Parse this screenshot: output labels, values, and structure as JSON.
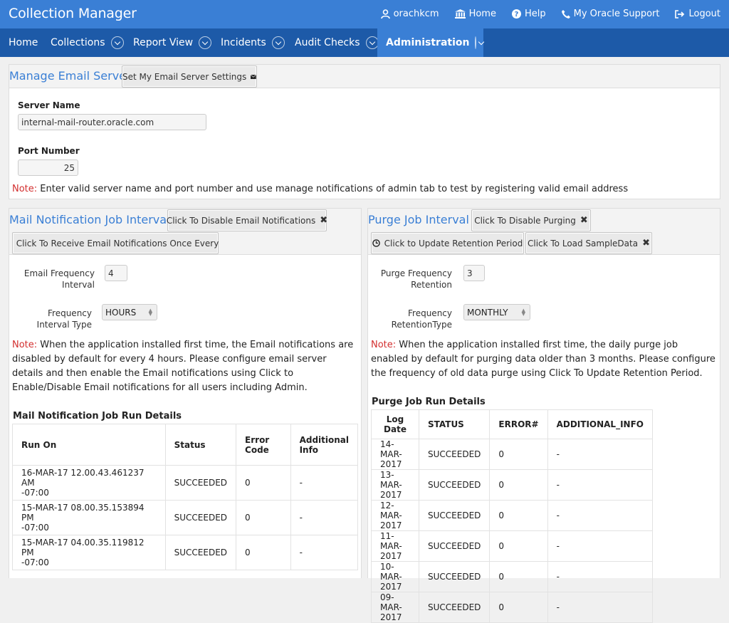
{
  "app": {
    "title": "Collection Manager"
  },
  "top_links": {
    "user": "orachkcm",
    "home": "Home",
    "help": "Help",
    "support": "My Oracle Support",
    "logout": "Logout"
  },
  "nav": {
    "home": "Home",
    "collections": "Collections",
    "report_view": "Report View",
    "incidents": "Incidents",
    "audit_checks": "Audit Checks",
    "administration": "Administration"
  },
  "email_server": {
    "title": "Manage Email Server",
    "set_button": "Set My Email Server Settings",
    "server_label": "Server Name",
    "server_value": "internal-mail-router.oracle.com",
    "port_label": "Port Number",
    "port_value": "25",
    "note_prefix": "Note:",
    "note_text": " Enter valid server name and port number and use manage notifications of admin tab to test by registering valid email address"
  },
  "mail_job": {
    "title": "Mail Notification Job Interval",
    "disable_button": "Click To Disable Email Notifications",
    "receive_button": "Click To Receive Email Notifications Once Every",
    "freq_label_1": "Email Frequency",
    "freq_label_2": "Interval",
    "freq_value": "4",
    "type_label_1": "Frequency",
    "type_label_2": "Interval Type",
    "type_value": "HOURS",
    "note_prefix": "Note:",
    "note_text": " When the application installed first time, the Email notifications are disabled by default for every 4 hours. Please configure email server details and then enable the Email notifications using Click to Enable/Disable Email notifications for all users including Admin.",
    "runs_title": "Mail Notification Job Run Details",
    "headers": {
      "run_on": "Run On",
      "status": "Status",
      "error_1": "Error",
      "error_2": "Code",
      "info_1": "Additional",
      "info_2": "Info"
    },
    "rows": [
      {
        "run_on_1": "16-MAR-17 12.00.43.461237 AM",
        "run_on_2": "-07:00",
        "status": "SUCCEEDED",
        "code": "0",
        "info": "-"
      },
      {
        "run_on_1": "15-MAR-17 08.00.35.153894 PM",
        "run_on_2": "-07:00",
        "status": "SUCCEEDED",
        "code": "0",
        "info": "-"
      },
      {
        "run_on_1": "15-MAR-17 04.00.35.119812 PM",
        "run_on_2": "-07:00",
        "status": "SUCCEEDED",
        "code": "0",
        "info": "-"
      }
    ]
  },
  "purge_job": {
    "title": "Purge Job Interval",
    "disable_button": "Click To Disable Purging",
    "update_button": "Click to Update Retention Period",
    "load_button": "Click To Load SampleData",
    "freq_label_1": "Purge Frequency",
    "freq_label_2": "Retention",
    "freq_value": "3",
    "type_label_1": "Frequency",
    "type_label_2": "RetentionType",
    "type_value": "MONTHLY",
    "note_prefix": "Note:",
    "note_text": " When the application installed first time, the daily purge job enabled by default for purging data older than 3 months. Please configure the frequency of old data purge using Click To Update Retention Period.",
    "runs_title": "Purge Job Run Details",
    "headers": {
      "date": "Log Date",
      "status": "STATUS",
      "error": "ERROR#",
      "info": "ADDITIONAL_INFO"
    },
    "rows": [
      {
        "date": "14-MAR-2017",
        "status": "SUCCEEDED",
        "error": "0",
        "info": "-"
      },
      {
        "date": "13-MAR-2017",
        "status": "SUCCEEDED",
        "error": "0",
        "info": "-"
      },
      {
        "date": "12-MAR-2017",
        "status": "SUCCEEDED",
        "error": "0",
        "info": "-"
      },
      {
        "date": "11-MAR-2017",
        "status": "SUCCEEDED",
        "error": "0",
        "info": "-"
      },
      {
        "date": "10-MAR-2017",
        "status": "SUCCEEDED",
        "error": "0",
        "info": "-"
      },
      {
        "date": "09-MAR-2017",
        "status": "SUCCEEDED",
        "error": "0",
        "info": "-"
      }
    ]
  }
}
